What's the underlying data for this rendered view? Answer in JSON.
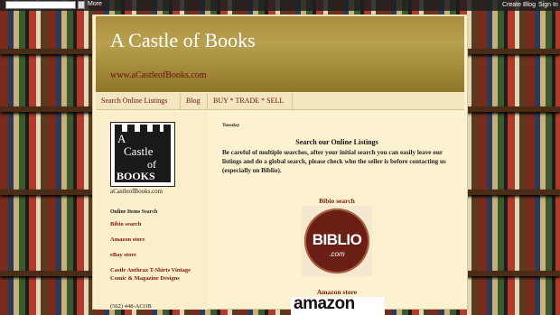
{
  "navbar": {
    "more_label": "More",
    "create_blog": "Create Blog",
    "sign_in": "Sign In"
  },
  "header": {
    "title": "A Castle of Books",
    "url": "www.aCastleofBooks.com"
  },
  "tabs": [
    {
      "label": "Search Online Listings"
    },
    {
      "label": "Blog"
    },
    {
      "label": "BUY * TRADE * SELL"
    }
  ],
  "sidebar": {
    "logo_caption": "aCastleofBooks.com",
    "heading": "Online Items Search",
    "links": [
      {
        "label": "Bibio search"
      },
      {
        "label": "Amazon store"
      },
      {
        "label": "eBay store"
      },
      {
        "label": "Castle Anthrax T-Shirts Vintage Comic & Magazine Designs"
      }
    ],
    "phone": "(562) 448-ACOB"
  },
  "post": {
    "date": "Tuesday",
    "title": "Search our Online Listings",
    "body": "Be careful of multiple searches, after your initial search you can easily leave our listings and do a global search, please check who the seller is before contacting us (especially on Biblio).",
    "biblio_label": "Bibio search",
    "biblio_logo_text": "BIBLIO",
    "biblio_logo_sub": ".com",
    "amazon_label": "Amazon store",
    "amazon_logo_text": "amazon"
  },
  "logo_words": [
    "A",
    "Castle",
    "of",
    "BOOKS"
  ],
  "colors": {
    "header_gold": "#a98d3c",
    "link_red": "#7a1a0a",
    "page_bg": "#fdf2d0",
    "biblio_badge": "#6b1e16"
  }
}
